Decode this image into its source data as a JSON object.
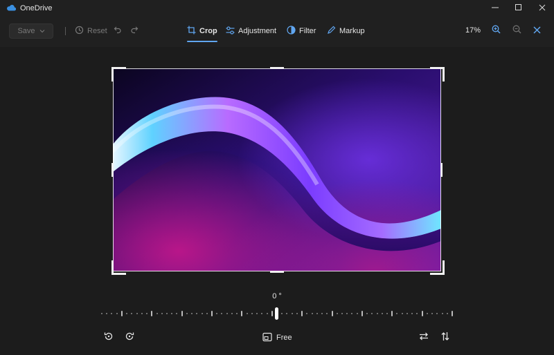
{
  "window": {
    "title": "OneDrive",
    "icons": [
      "onedrive-cloud-icon",
      "minimize-icon",
      "maximize-icon",
      "close-icon"
    ]
  },
  "toolbar": {
    "save_label": "Save",
    "reset_label": "Reset",
    "tabs": [
      {
        "label": "Crop",
        "icon": "crop-icon",
        "active": true
      },
      {
        "label": "Adjustment",
        "icon": "sliders-icon",
        "active": false
      },
      {
        "label": "Filter",
        "icon": "filter-icon",
        "active": false
      },
      {
        "label": "Markup",
        "icon": "pen-icon",
        "active": false
      }
    ],
    "zoom": "17%"
  },
  "crop": {
    "angle": "0 °",
    "aspect_label": "Free",
    "rotation_degrees": 0
  },
  "colors": {
    "accent": "#60a6f0",
    "background": "#1c1c1c",
    "toolbar": "#202020"
  }
}
